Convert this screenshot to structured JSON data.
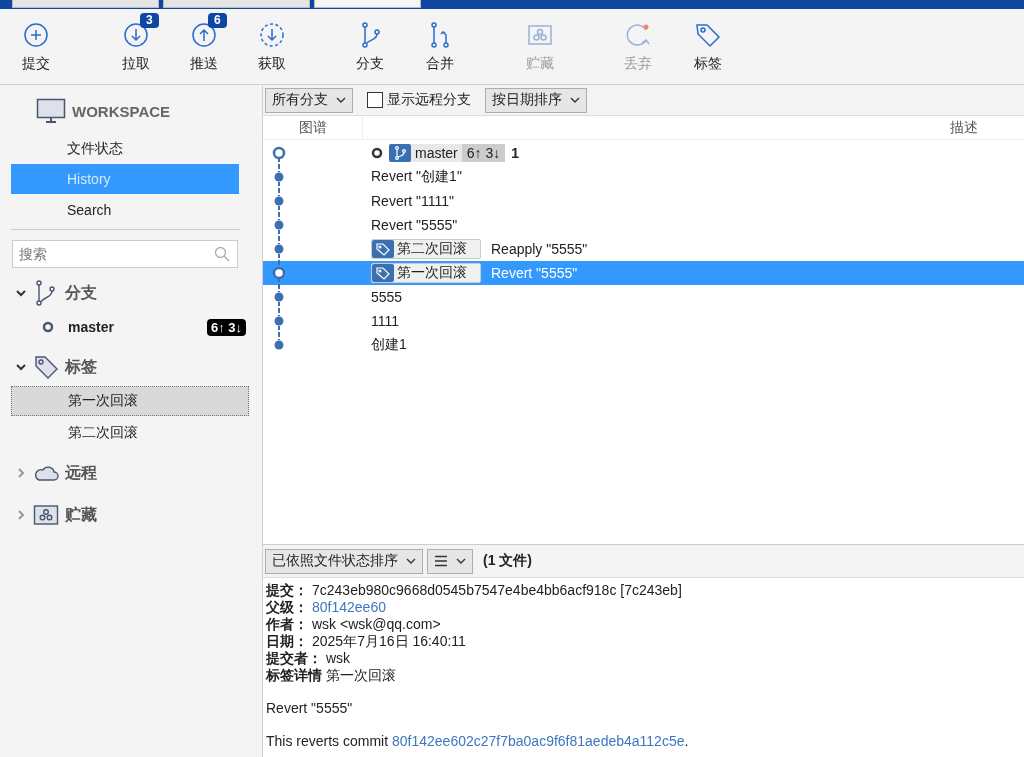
{
  "window_tabs": [
    {
      "selected": false
    },
    {
      "selected": false
    },
    {
      "selected": true
    }
  ],
  "toolbar": [
    {
      "kind": "commit",
      "label": "提交",
      "disabled": false
    },
    {
      "kind": "pull",
      "label": "拉取",
      "disabled": false,
      "badge": "3"
    },
    {
      "kind": "push",
      "label": "推送",
      "disabled": false,
      "badge": "6"
    },
    {
      "kind": "fetch",
      "label": "获取",
      "disabled": false
    },
    {
      "kind": "branch",
      "label": "分支",
      "disabled": false
    },
    {
      "kind": "merge",
      "label": "合并",
      "disabled": false
    },
    {
      "kind": "stash",
      "label": "贮藏",
      "disabled": true
    },
    {
      "kind": "discard",
      "label": "丢弃",
      "disabled": true
    },
    {
      "kind": "tag",
      "label": "标签",
      "disabled": false
    }
  ],
  "sidebar": {
    "workspace": "WORKSPACE",
    "items": [
      {
        "label": "文件状态",
        "selected": false
      },
      {
        "label": "History",
        "selected": true
      },
      {
        "label": "Search",
        "selected": false
      }
    ],
    "search": {
      "placeholder": "搜索"
    },
    "sections": [
      {
        "kind": "branches",
        "label": "分支",
        "expanded": true,
        "items": [
          {
            "label": "master",
            "badge": "6↑ 3↓",
            "selected": false
          }
        ]
      },
      {
        "kind": "tags",
        "label": "标签",
        "expanded": true,
        "items": [
          {
            "label": "第一次回滚",
            "selected": true
          },
          {
            "label": "第二次回滚",
            "selected": false
          }
        ]
      },
      {
        "kind": "remotes",
        "label": "远程",
        "expanded": false
      },
      {
        "kind": "stashes",
        "label": "贮藏",
        "expanded": false
      }
    ]
  },
  "graph_toolbar": {
    "branch_filter": "所有分支",
    "show_remote": {
      "label": "显示远程分支",
      "checked": false
    },
    "sort": "按日期排序"
  },
  "columns": [
    "图谱",
    "描述"
  ],
  "commits": [
    {
      "message": "1",
      "current": true,
      "selected": false,
      "branch": {
        "name": "master",
        "badge": "6↑ 3↓"
      }
    },
    {
      "message": "Revert \"创建1\"",
      "current": false,
      "selected": false
    },
    {
      "message": "Revert \"1111\"",
      "current": false,
      "selected": false
    },
    {
      "message": "Revert \"5555\"",
      "current": false,
      "selected": false
    },
    {
      "message": "Reapply \"5555\"",
      "current": false,
      "selected": false,
      "tag": "第二次回滚"
    },
    {
      "message": "Revert \"5555\"",
      "current": false,
      "selected": true,
      "tag": "第一次回滚"
    },
    {
      "message": "5555",
      "current": false,
      "selected": false
    },
    {
      "message": "1111",
      "current": false,
      "selected": false
    },
    {
      "message": "创建1",
      "current": false,
      "selected": false
    }
  ],
  "files_toolbar": {
    "sort": "已依照文件状态排序",
    "count": "(1 文件)"
  },
  "details": {
    "fields": [
      {
        "label": "提交：",
        "value": "7c243eb980c9668d0545b7547e4be4bb6acf918c [7c243eb]",
        "kind": "text"
      },
      {
        "label": "父级：",
        "value": "80f142ee60",
        "kind": "link"
      },
      {
        "label": "作者：",
        "value": "wsk <wsk@qq.com>",
        "kind": "text"
      },
      {
        "label": "日期：",
        "value": "2025年7月16日 16:40:11",
        "kind": "text"
      },
      {
        "label": "提交者：",
        "value": "wsk",
        "kind": "text"
      },
      {
        "label": "标签详情",
        "value": "第一次回滚",
        "kind": "text"
      }
    ],
    "subject": "Revert \"5555\"",
    "body": "This reverts commit ",
    "body_link": "80f142ee602c27f7ba0ac9f6f81aedeb4a112c5e",
    "body_end": "."
  }
}
